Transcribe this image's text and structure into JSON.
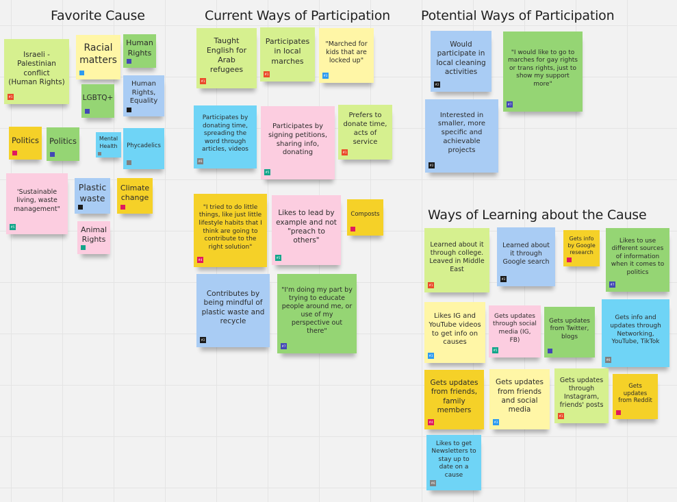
{
  "board": {
    "background": "#f2f2f2",
    "sections": [
      {
        "id": "favorite-cause",
        "title": "Favorite Cause"
      },
      {
        "id": "current-ways",
        "title": "Current Ways of Participation"
      },
      {
        "id": "potential-ways",
        "title": "Potential Ways of Participation"
      },
      {
        "id": "ways-of-learning",
        "title": "Ways of Learning about the Cause"
      }
    ],
    "tag_colors": {
      "#1": "#ea4a2a",
      "#2": "#1a1a1a",
      "#3": "#2d9bf0",
      "#4": "#e0195e",
      "#5": "#13a58a",
      "#6": "#808080",
      "#7": "#4347b5"
    },
    "favorite_cause": [
      {
        "text": "Israeli - Palestinian conflict (Human Rights)",
        "color": "lime",
        "tag": "#1"
      },
      {
        "text": "Racial matters",
        "color": "yellow",
        "tag": "#3"
      },
      {
        "text": "Human Rights",
        "color": "green",
        "tag": "#7"
      },
      {
        "text": "LGBTQ+",
        "color": "green",
        "tag": "#7"
      },
      {
        "text": "Human Rights, Equality",
        "color": "blue",
        "tag": "#2"
      },
      {
        "text": "Politics",
        "color": "gold",
        "tag": "#4"
      },
      {
        "text": "Politics",
        "color": "green",
        "tag": "#7"
      },
      {
        "text": "Mental Health",
        "color": "cyan",
        "tag": "#6"
      },
      {
        "text": "Phycadelics",
        "color": "cyan",
        "tag": "#6"
      },
      {
        "text": "'Sustainable living, waste management\"",
        "color": "pink",
        "tag": "#5"
      },
      {
        "text": "Plastic waste",
        "color": "blue",
        "tag": "#2"
      },
      {
        "text": "Climate change",
        "color": "gold",
        "tag": "#4"
      },
      {
        "text": "Animal Rights",
        "color": "pink",
        "tag": "#5"
      }
    ],
    "current_ways": [
      {
        "text": "Taught English for Arab refugees",
        "color": "lime",
        "tag": "#1"
      },
      {
        "text": "Participates in local marches",
        "color": "lime",
        "tag": "#1"
      },
      {
        "text": "\"Marched for kids that are locked up\"",
        "color": "yellow",
        "tag": "#3"
      },
      {
        "text": "Participates by donating time, spreading the word through articles, videos",
        "color": "cyan",
        "tag": "#6"
      },
      {
        "text": "Participates by signing petitions, sharing info, donating",
        "color": "pink",
        "tag": "#5"
      },
      {
        "text": "Prefers to donate time, acts of service",
        "color": "lime",
        "tag": "#1"
      },
      {
        "text": "\"I tried to do little things, like just little lifestyle habits that I think are going to contribute to the right solution\"",
        "color": "gold",
        "tag": "#4"
      },
      {
        "text": "Likes to lead by example and not \"preach to others\"",
        "color": "pink",
        "tag": "#5"
      },
      {
        "text": "Composts",
        "color": "gold",
        "tag": "#4"
      },
      {
        "text": "Contributes  by being mindful of plastic waste and recycle",
        "color": "blue",
        "tag": "#2"
      },
      {
        "text": "\"I'm doing my part by trying to educate people around me, or use of my perspective out there\"",
        "color": "green",
        "tag": "#7"
      }
    ],
    "potential_ways": [
      {
        "text": "Would participate in local cleaning activities",
        "color": "blue",
        "tag": "#2"
      },
      {
        "text": "\"I would like to go to marches for gay rights or trans rights, just to  show my support more\"",
        "color": "green",
        "tag": "#7"
      },
      {
        "text": "Interested in smaller, more specific and achievable projects",
        "color": "blue",
        "tag": "#2"
      }
    ],
    "ways_of_learning": [
      {
        "text": "Learned about it through college. Leaved in Middle East",
        "color": "lime",
        "tag": "#1"
      },
      {
        "text": "Learned about it through Google search",
        "color": "blue",
        "tag": "#2"
      },
      {
        "text": "Gets info by Google research",
        "color": "gold",
        "tag": "#4"
      },
      {
        "text": "Likes to use different sources of information when it comes to politics",
        "color": "green",
        "tag": "#7"
      },
      {
        "text": "Likes IG and YouTube videos to get info on causes",
        "color": "yellow",
        "tag": "#3"
      },
      {
        "text": "Gets updates through social media (IG, FB)",
        "color": "pink",
        "tag": "#5"
      },
      {
        "text": "Gets updates from Twitter, blogs",
        "color": "green",
        "tag": "#7"
      },
      {
        "text": "Gets info and updates through Networking, YouTube, TikTok",
        "color": "cyan",
        "tag": "#6"
      },
      {
        "text": "Gets updates from friends, family members",
        "color": "gold",
        "tag": "#4"
      },
      {
        "text": "Gets updates from friends and social media",
        "color": "yellow",
        "tag": "#3"
      },
      {
        "text": "Gets updates through Instagram, friends' posts",
        "color": "lime",
        "tag": "#1"
      },
      {
        "text": "Gets updates from Reddit",
        "color": "gold",
        "tag": "#4"
      },
      {
        "text": "Likes to get Newsletters to stay up to date on a cause",
        "color": "cyan",
        "tag": "#6"
      }
    ]
  }
}
